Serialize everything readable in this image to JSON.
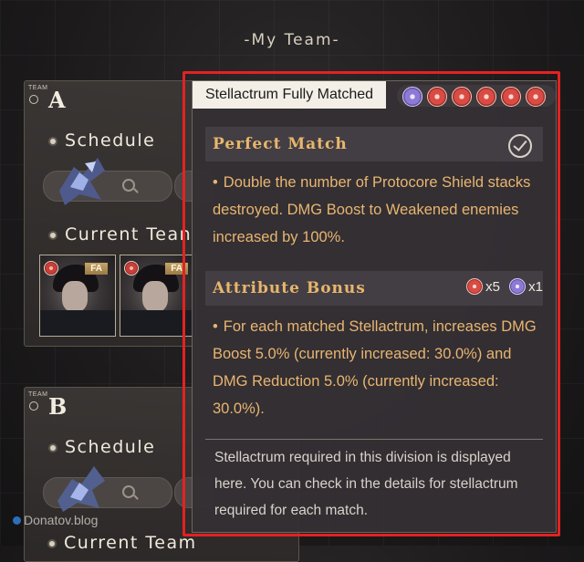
{
  "page_title": "-My Team-",
  "team_a": {
    "tag": "TEAM",
    "letter": "A",
    "schedule_label": "Schedule",
    "current_team_label": "Current Tean",
    "cards": [
      {
        "badge": "FA"
      },
      {
        "badge": "FA"
      }
    ]
  },
  "team_b": {
    "tag": "TEAM",
    "letter": "B",
    "schedule_label": "Schedule",
    "current_team_label": "Current Team"
  },
  "tooltip": {
    "title": "Stellactrum Fully Matched",
    "chips": [
      "purple",
      "red",
      "red",
      "red",
      "red",
      "red"
    ],
    "perfect_match": {
      "heading": "Perfect Match",
      "text": "Double the number of Protocore Shield stacks destroyed. DMG Boost to Weakened enemies increased by 100%."
    },
    "attribute_bonus": {
      "heading": "Attribute Bonus",
      "red_count": "x5",
      "purple_count": "x1",
      "text": "For each matched Stellactrum, increases DMG Boost 5.0% (currently increased: 30.0%) and DMG Reduction 5.0% (currently increased: 30.0%)."
    },
    "note": "Stellactrum required in this division is displayed here. You can check in the details for stellactrum required for each match."
  },
  "watermark": "Donatov.blog",
  "colors": {
    "accent_gold": "#e9b570",
    "highlight_red": "#e32222",
    "chip_red": "#d94c46",
    "chip_purple": "#8d7ad6"
  }
}
